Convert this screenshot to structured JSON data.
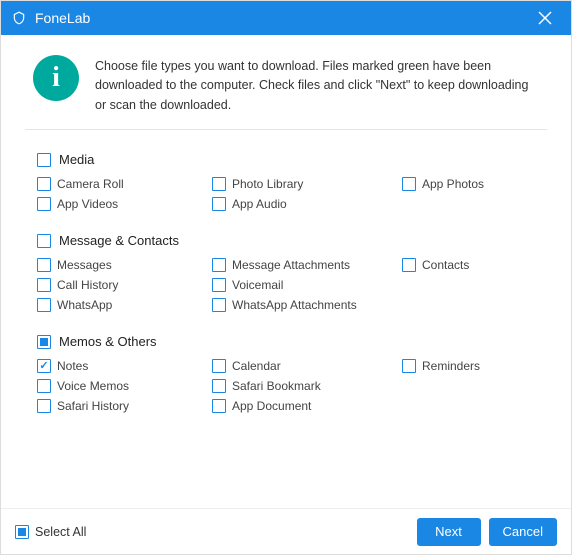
{
  "window": {
    "title": "FoneLab"
  },
  "intro": {
    "text": "Choose file types you want to download. Files marked green have been downloaded to the computer. Check files and click \"Next\" to keep downloading or scan the downloaded."
  },
  "categories": [
    {
      "id": "media",
      "title": "Media",
      "state": "unchecked",
      "items": [
        {
          "id": "camera-roll",
          "label": "Camera Roll",
          "checked": false
        },
        {
          "id": "photo-library",
          "label": "Photo Library",
          "checked": false
        },
        {
          "id": "app-photos",
          "label": "App Photos",
          "checked": false
        },
        {
          "id": "app-videos",
          "label": "App Videos",
          "checked": false
        },
        {
          "id": "app-audio",
          "label": "App Audio",
          "checked": false
        }
      ]
    },
    {
      "id": "message-contacts",
      "title": "Message & Contacts",
      "state": "unchecked",
      "items": [
        {
          "id": "messages",
          "label": "Messages",
          "checked": false
        },
        {
          "id": "message-attachments",
          "label": "Message Attachments",
          "checked": false
        },
        {
          "id": "contacts",
          "label": "Contacts",
          "checked": false
        },
        {
          "id": "call-history",
          "label": "Call History",
          "checked": false
        },
        {
          "id": "voicemail",
          "label": "Voicemail",
          "checked": false
        },
        {
          "id": "whatsapp-spacer",
          "label": "",
          "checked": null
        },
        {
          "id": "whatsapp",
          "label": "WhatsApp",
          "checked": false
        },
        {
          "id": "whatsapp-attachments",
          "label": "WhatsApp Attachments",
          "checked": false
        }
      ]
    },
    {
      "id": "memos-others",
      "title": "Memos & Others",
      "state": "indeterminate",
      "items": [
        {
          "id": "notes",
          "label": "Notes",
          "checked": true
        },
        {
          "id": "calendar",
          "label": "Calendar",
          "checked": false
        },
        {
          "id": "reminders",
          "label": "Reminders",
          "checked": false
        },
        {
          "id": "voice-memos",
          "label": "Voice Memos",
          "checked": false
        },
        {
          "id": "safari-bookmark",
          "label": "Safari Bookmark",
          "checked": false
        },
        {
          "id": "safari-spacer",
          "label": "",
          "checked": null
        },
        {
          "id": "safari-history",
          "label": "Safari History",
          "checked": false
        },
        {
          "id": "app-document",
          "label": "App Document",
          "checked": false
        }
      ]
    }
  ],
  "footer": {
    "selectAll": {
      "label": "Select All",
      "state": "indeterminate"
    },
    "next": "Next",
    "cancel": "Cancel"
  }
}
